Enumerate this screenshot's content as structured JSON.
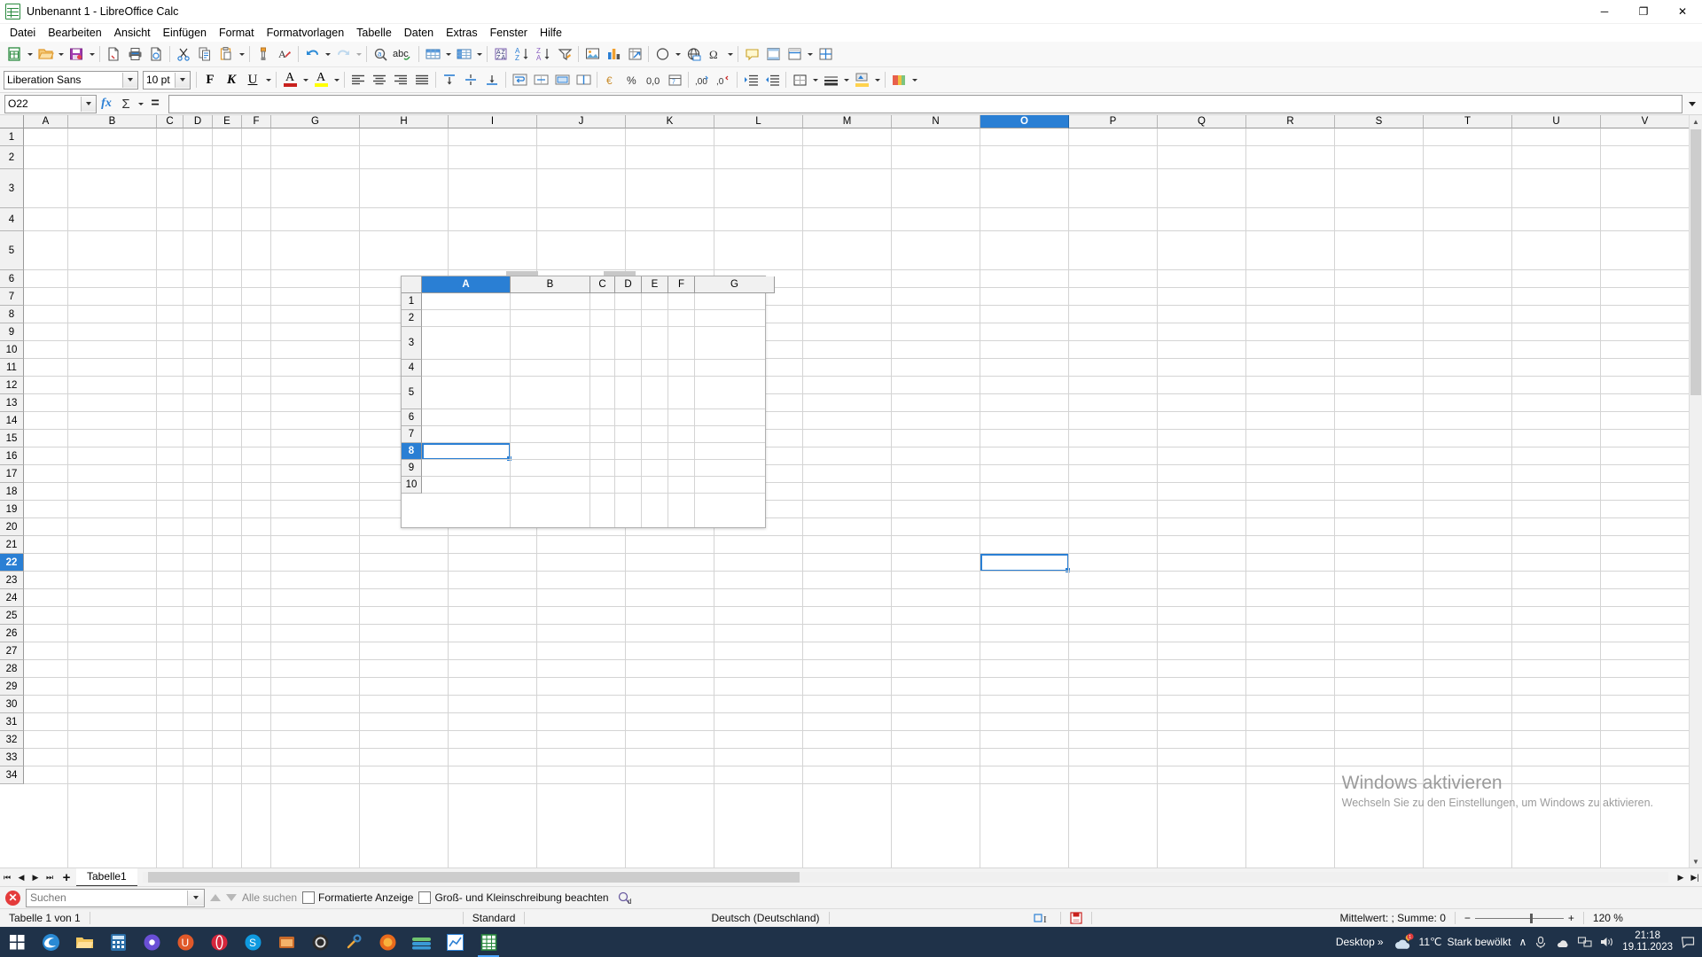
{
  "window": {
    "title": "Unbenannt 1 - LibreOffice Calc",
    "minimize": "─",
    "maximize": "❐",
    "close": "✕"
  },
  "menubar": {
    "items": [
      {
        "label": "Datei"
      },
      {
        "label": "Bearbeiten"
      },
      {
        "label": "Ansicht"
      },
      {
        "label": "Einfügen"
      },
      {
        "label": "Format"
      },
      {
        "label": "Formatvorlagen"
      },
      {
        "label": "Tabelle"
      },
      {
        "label": "Daten"
      },
      {
        "label": "Extras"
      },
      {
        "label": "Fenster"
      },
      {
        "label": "Hilfe"
      }
    ]
  },
  "standard_toolbar": {
    "items": [
      "new-document-icon",
      "new-document-dropdown",
      "open-icon",
      "open-dropdown",
      "save-icon",
      "save-dropdown",
      "separator",
      "export-pdf-icon",
      "print-icon",
      "print-preview-icon",
      "separator",
      "cut-icon",
      "copy-icon",
      "paste-icon",
      "paste-dropdown",
      "separator",
      "clone-formatting-icon",
      "clear-formatting-icon",
      "separator",
      "undo-icon",
      "undo-dropdown",
      "redo-icon",
      "redo-dropdown",
      "separator",
      "find-replace-icon",
      "spelling-icon",
      "separator",
      "row-icon",
      "row-dropdown",
      "column-icon",
      "column-dropdown",
      "separator",
      "sort-icon",
      "sort-ascending-icon",
      "sort-descending-icon",
      "autofilter-icon",
      "separator",
      "insert-image-icon",
      "insert-chart-icon",
      "pivot-table-icon",
      "separator",
      "shapes-icon",
      "shapes-dropdown",
      "hyperlink-icon",
      "special-character-icon",
      "special-character-dropdown",
      "separator",
      "comment-icon",
      "headers-footers-icon",
      "freeze-rows-columns-icon",
      "freeze-dropdown",
      "split-window-icon"
    ]
  },
  "formatting_toolbar": {
    "font_name": "Liberation Sans",
    "font_size": "10 pt",
    "bold_label": "F",
    "italic_label": "K",
    "underline_label": "U",
    "font_color_label": "A",
    "highlight_label": "A",
    "font_color": "#c9211e",
    "highlight_color": "#ffff00",
    "items": [
      "bold-button",
      "italic-button",
      "underline-button",
      "underline-dropdown",
      "font-color-button",
      "font-color-dropdown",
      "highlight-color-button",
      "highlight-color-dropdown",
      "align-left-button",
      "align-center-button",
      "align-right-button",
      "align-justified-button",
      "align-top-button",
      "align-center-vertical-button",
      "align-bottom-button",
      "wrap-text-button",
      "merge-cells-button",
      "merge-center-button",
      "unmerge-button",
      "format-currency-button",
      "format-percent-button",
      "format-number-button",
      "format-date-button",
      "add-decimal-button",
      "delete-decimal-button",
      "indent-increase-button",
      "indent-decrease-button",
      "borders-button",
      "borders-dropdown",
      "border-style-button",
      "border-style-dropdown",
      "background-color-button",
      "background-color-dropdown",
      "conditional-formatting-button",
      "conditional-dropdown"
    ]
  },
  "formula_bar": {
    "name_box_value": "O22",
    "name_box_placeholder": "",
    "function_wizard_label": "fx",
    "sum_label": "Σ",
    "formula_label": "=",
    "input_value": "",
    "input_placeholder": ""
  },
  "grid": {
    "column_headers": [
      "A",
      "B",
      "C",
      "D",
      "E",
      "F",
      "G",
      "H",
      "I",
      "J",
      "K",
      "L",
      "M",
      "N",
      "O",
      "P",
      "Q",
      "R",
      "S",
      "T",
      "U",
      "V"
    ],
    "selected_column": "O",
    "row_headers": [
      "1",
      "2",
      "3",
      "4",
      "5",
      "6",
      "7",
      "8",
      "9",
      "10",
      "11",
      "12",
      "13",
      "14",
      "15",
      "16",
      "17",
      "18",
      "19",
      "20",
      "21",
      "22",
      "23",
      "24",
      "25",
      "26",
      "27",
      "28",
      "29",
      "30",
      "31",
      "32",
      "33",
      "34"
    ],
    "selected_row": "22",
    "active_cell": "O22",
    "cell_values": []
  },
  "float_sheet": {
    "column_headers": [
      "A",
      "B",
      "C",
      "D",
      "E",
      "F",
      "G"
    ],
    "selected_column": "A",
    "row_headers": [
      "1",
      "2",
      "3",
      "4",
      "5",
      "6",
      "7",
      "8",
      "9",
      "10"
    ],
    "selected_row": "8",
    "active_cell": "A8"
  },
  "sheet_tabs": {
    "first_label": "⏮",
    "prev_label": "◀",
    "next_label": "▶",
    "last_label": "⏭",
    "add_label": "+",
    "tabs": [
      {
        "label": "Tabelle1",
        "active": true
      }
    ]
  },
  "find_bar": {
    "close_label": "✕",
    "search_value": "",
    "search_placeholder": "Suchen",
    "find_previous": "find-previous-icon",
    "find_next": "find-next-icon",
    "find_all_label": "Alle suchen",
    "formatted_display_label": "Formatierte Anzeige",
    "match_case_label": "Groß- und Kleinschreibung beachten",
    "find_replace_label": "find-and-replace-icon"
  },
  "status_bar": {
    "sheet_info": "Tabelle 1 von 1",
    "page_style": "Standard",
    "language": "Deutsch (Deutschland)",
    "insert_mode": "selection-mode-icon",
    "save_state": "document-modified-icon",
    "summary": "Mittelwert: ; Summe: 0",
    "zoom_out": "−",
    "zoom_in": "+",
    "zoom_level": "120 %"
  },
  "watermark": {
    "line1": "Windows aktivieren",
    "line2": "Wechseln Sie zu den Einstellungen, um Windows zu aktivieren."
  },
  "taskbar": {
    "start_label": "start-icon",
    "apps": [
      "edge-icon",
      "file-explorer-icon",
      "calculator-icon",
      "loom-icon",
      "ubuntu-icon",
      "opera-icon",
      "skype-icon",
      "store-icon",
      "obs-icon",
      "tools-icon",
      "firefox-icon",
      "money-icon",
      "chart-app-icon",
      "libreoffice-calc-icon"
    ],
    "desktop_label": "Desktop",
    "overflow_label": "»",
    "weather_temp": "11℃",
    "weather_text": "Stark bewölkt",
    "tray_chevron": "∧",
    "tray_icons": [
      "mic-icon",
      "cloud-icon",
      "network-icon",
      "volume-icon"
    ],
    "time": "21:18",
    "date": "19.11.2023",
    "notification": "notification-icon"
  }
}
